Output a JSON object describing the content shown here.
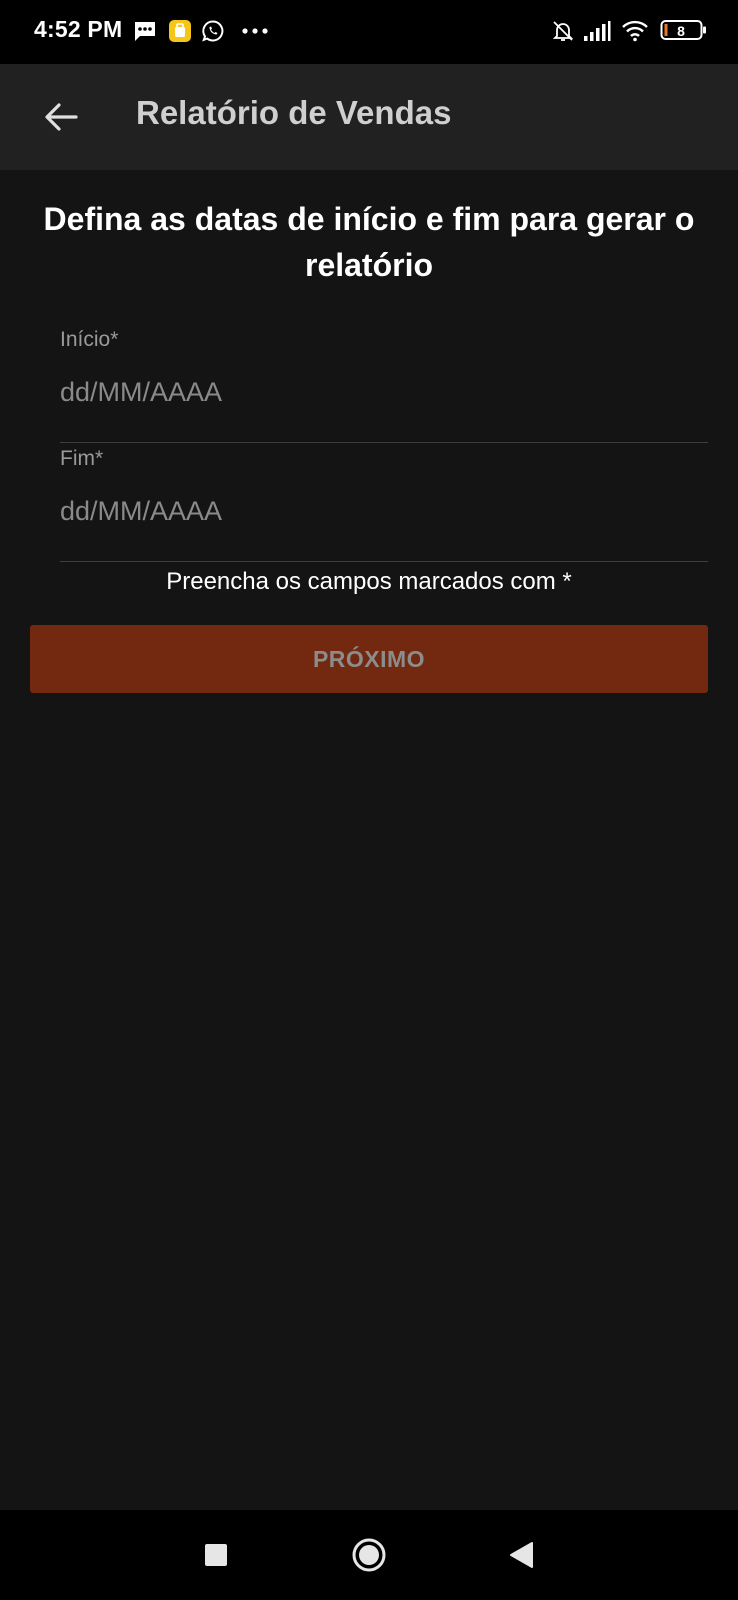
{
  "status_bar": {
    "time": "4:52 PM",
    "battery_level": "8",
    "icons": [
      "sms-icon",
      "app-notification-icon",
      "whatsapp-icon",
      "more-dots-icon",
      "notifications-muted-icon",
      "signal-icon",
      "wifi-icon",
      "battery-icon"
    ]
  },
  "app_bar": {
    "title": "Relatório de Vendas",
    "back_icon": "arrow-back-icon"
  },
  "form": {
    "heading": "Defina as datas de início e fim para gerar o relatório",
    "start": {
      "label": "Início*",
      "value": "",
      "placeholder": "dd/MM/AAAA"
    },
    "end": {
      "label": "Fim*",
      "value": "",
      "placeholder": "dd/MM/AAAA"
    },
    "hint": "Preencha os campos marcados com *",
    "next_label": "PRÓXIMO"
  },
  "nav_bar": {
    "icons": [
      "recents-square-icon",
      "home-circle-icon",
      "back-triangle-icon"
    ]
  },
  "colors": {
    "background": "#141414",
    "app_bar": "#212121",
    "accent_button": "#722910",
    "app_icon_yellow": "#f5c518"
  }
}
